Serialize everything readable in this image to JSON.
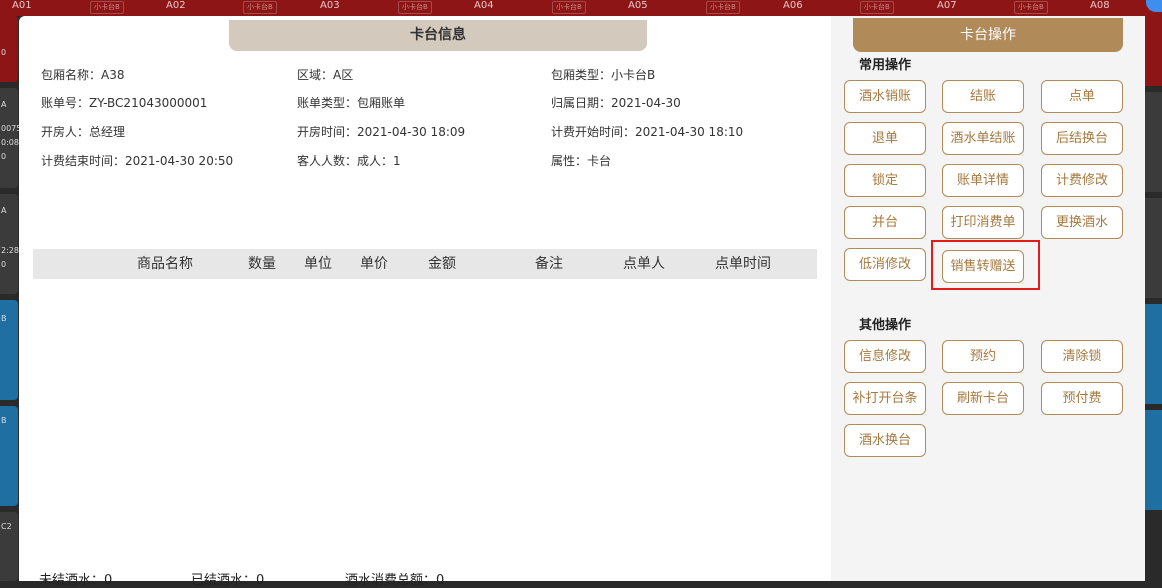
{
  "background": {
    "rooms_top": [
      {
        "label": "A01",
        "tag": ""
      },
      {
        "label": "A02",
        "tag": "小卡台B"
      },
      {
        "label": "A03",
        "tag": "小卡台B"
      },
      {
        "label": "A04",
        "tag": "小卡台B"
      },
      {
        "label": "A05",
        "tag": "小卡台B"
      },
      {
        "label": "A06",
        "tag": "小卡台B"
      },
      {
        "label": "A07",
        "tag": "小卡台B"
      },
      {
        "label": "A08",
        "tag": "小卡台B"
      }
    ],
    "side_numbers": [
      "0",
      "A",
      "0075",
      "0:08",
      "0",
      "A",
      "2:28",
      "0",
      "B",
      "B",
      "C2"
    ]
  },
  "info_panel": {
    "title": "卡台信息",
    "fields": {
      "room_name": "包厢名称：A38",
      "area": "区域：A区",
      "room_type": "包厢类型：小卡台B",
      "bill_no": "账单号：ZY-BC21043000001",
      "bill_type": "账单类型：包厢账单",
      "belong_date": "归属日期：2021-04-30",
      "opener": "开房人：总经理",
      "open_time": "开房时间：2021-04-30 18:09",
      "billing_start": "计费开始时间：2021-04-30 18:10",
      "billing_end": "计费结束时间：2021-04-30 20:50",
      "guests": "客人人数：成人：1",
      "attribute": "属性：卡台"
    },
    "table": {
      "columns": [
        "商品名称",
        "数量",
        "单位",
        "单价",
        "金额",
        "备注",
        "点单人",
        "点单时间"
      ],
      "rows": []
    },
    "footer": {
      "unsettled": "未结酒水：0",
      "settled": "已结酒水：0",
      "total": "酒水消费总额：0"
    }
  },
  "ops_panel": {
    "title": "卡台操作",
    "common_title": "常用操作",
    "common_buttons": [
      "酒水销账",
      "结账",
      "点单",
      "退单",
      "酒水单结账",
      "后结换台",
      "锁定",
      "账单详情",
      "计费修改",
      "并台",
      "打印消费单",
      "更换酒水",
      "低消修改",
      "销售转赠送"
    ],
    "other_title": "其他操作",
    "other_buttons": [
      "信息修改",
      "预约",
      "清除锁",
      "补打开台条",
      "刷新卡台",
      "预付费",
      "酒水换台"
    ],
    "highlighted_button": "销售转赠送",
    "colors": {
      "accent": "#b08a58",
      "highlight": "#e21c1c"
    }
  }
}
